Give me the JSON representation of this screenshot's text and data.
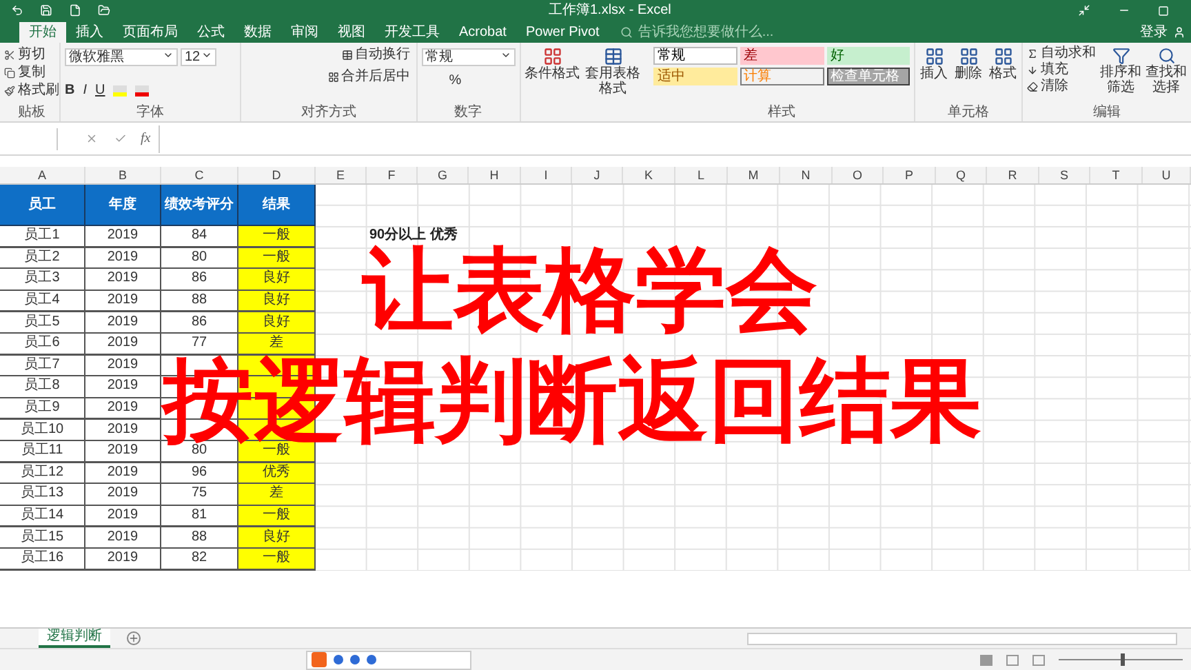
{
  "window": {
    "title": "工作簿1.xlsx - Excel",
    "sign_in": "登录"
  },
  "tabs": [
    {
      "label": "开始",
      "selected": true
    },
    {
      "label": "插入",
      "selected": false
    },
    {
      "label": "页面布局",
      "selected": false
    },
    {
      "label": "公式",
      "selected": false
    },
    {
      "label": "数据",
      "selected": false
    },
    {
      "label": "审阅",
      "selected": false
    },
    {
      "label": "视图",
      "selected": false
    },
    {
      "label": "开发工具",
      "selected": false
    },
    {
      "label": "Acrobat",
      "selected": false
    },
    {
      "label": "Power Pivot",
      "selected": false
    }
  ],
  "search": {
    "placeholder": "告诉我您想要做什么..."
  },
  "clipboard": {
    "items": [
      "剪切",
      "复制",
      "格式刷"
    ],
    "label": "贴板"
  },
  "font": {
    "name": "微软雅黑",
    "size": "12",
    "buttons": [
      "B",
      "I",
      "U"
    ],
    "label": "字体"
  },
  "alignment": {
    "wrap": "自动换行",
    "merge": "合并后居中",
    "label": "对齐方式"
  },
  "number": {
    "format": "常规",
    "percent": "%",
    "label": "数字"
  },
  "conditional_format": "条件格式",
  "table_format": "套用表格格式",
  "styles": {
    "cells": [
      {
        "label": "常规",
        "kind": "normal"
      },
      {
        "label": "差",
        "kind": "bad"
      },
      {
        "label": "好",
        "kind": "good"
      },
      {
        "label": "适中",
        "kind": "neutral"
      },
      {
        "label": "计算",
        "kind": "calculation"
      },
      {
        "label": "检查单元格",
        "kind": "check"
      }
    ],
    "label": "样式"
  },
  "cells_group": {
    "buttons": [
      "插入",
      "删除",
      "格式"
    ],
    "label": "单元格"
  },
  "editing": {
    "items": [
      "自动求和",
      "填充",
      "清除"
    ],
    "buttons": [
      "排序和筛选",
      "查找和选择"
    ],
    "label": "编辑"
  },
  "formula_bar": {
    "function_label": "fx"
  },
  "columns": [
    "A",
    "B",
    "C",
    "D",
    "E",
    "F",
    "G",
    "H",
    "I",
    "J",
    "K",
    "L",
    "M",
    "N",
    "O",
    "P",
    "Q",
    "R",
    "S",
    "T",
    "U"
  ],
  "table": {
    "headers": [
      "员工",
      "年度",
      "绩效考评分",
      "结果"
    ],
    "rows": [
      [
        "员工1",
        "2019",
        "84",
        "一般"
      ],
      [
        "员工2",
        "2019",
        "80",
        "一般"
      ],
      [
        "员工3",
        "2019",
        "86",
        "良好"
      ],
      [
        "员工4",
        "2019",
        "88",
        "良好"
      ],
      [
        "员工5",
        "2019",
        "86",
        "良好"
      ],
      [
        "员工6",
        "2019",
        "77",
        "差"
      ],
      [
        "员工7",
        "2019",
        null,
        null
      ],
      [
        "员工8",
        "2019",
        null,
        null
      ],
      [
        "员工9",
        "2019",
        null,
        null
      ],
      [
        "员工10",
        "2019",
        null,
        null
      ],
      [
        "员工11",
        "2019",
        "80",
        "一般"
      ],
      [
        "员工12",
        "2019",
        "96",
        "优秀"
      ],
      [
        "员工13",
        "2019",
        "75",
        "差"
      ],
      [
        "员工14",
        "2019",
        "81",
        "一般"
      ],
      [
        "员工15",
        "2019",
        "88",
        "良好"
      ],
      [
        "员工16",
        "2019",
        "82",
        "一般"
      ]
    ]
  },
  "notes": [
    "90分以上 优秀"
  ],
  "overlay": [
    "让表格学会",
    "按逻辑判断返回结果"
  ],
  "sheet_tabs": [
    {
      "label": "逻辑判断",
      "selected": true
    }
  ],
  "zoom": {
    "level": 0.5
  }
}
